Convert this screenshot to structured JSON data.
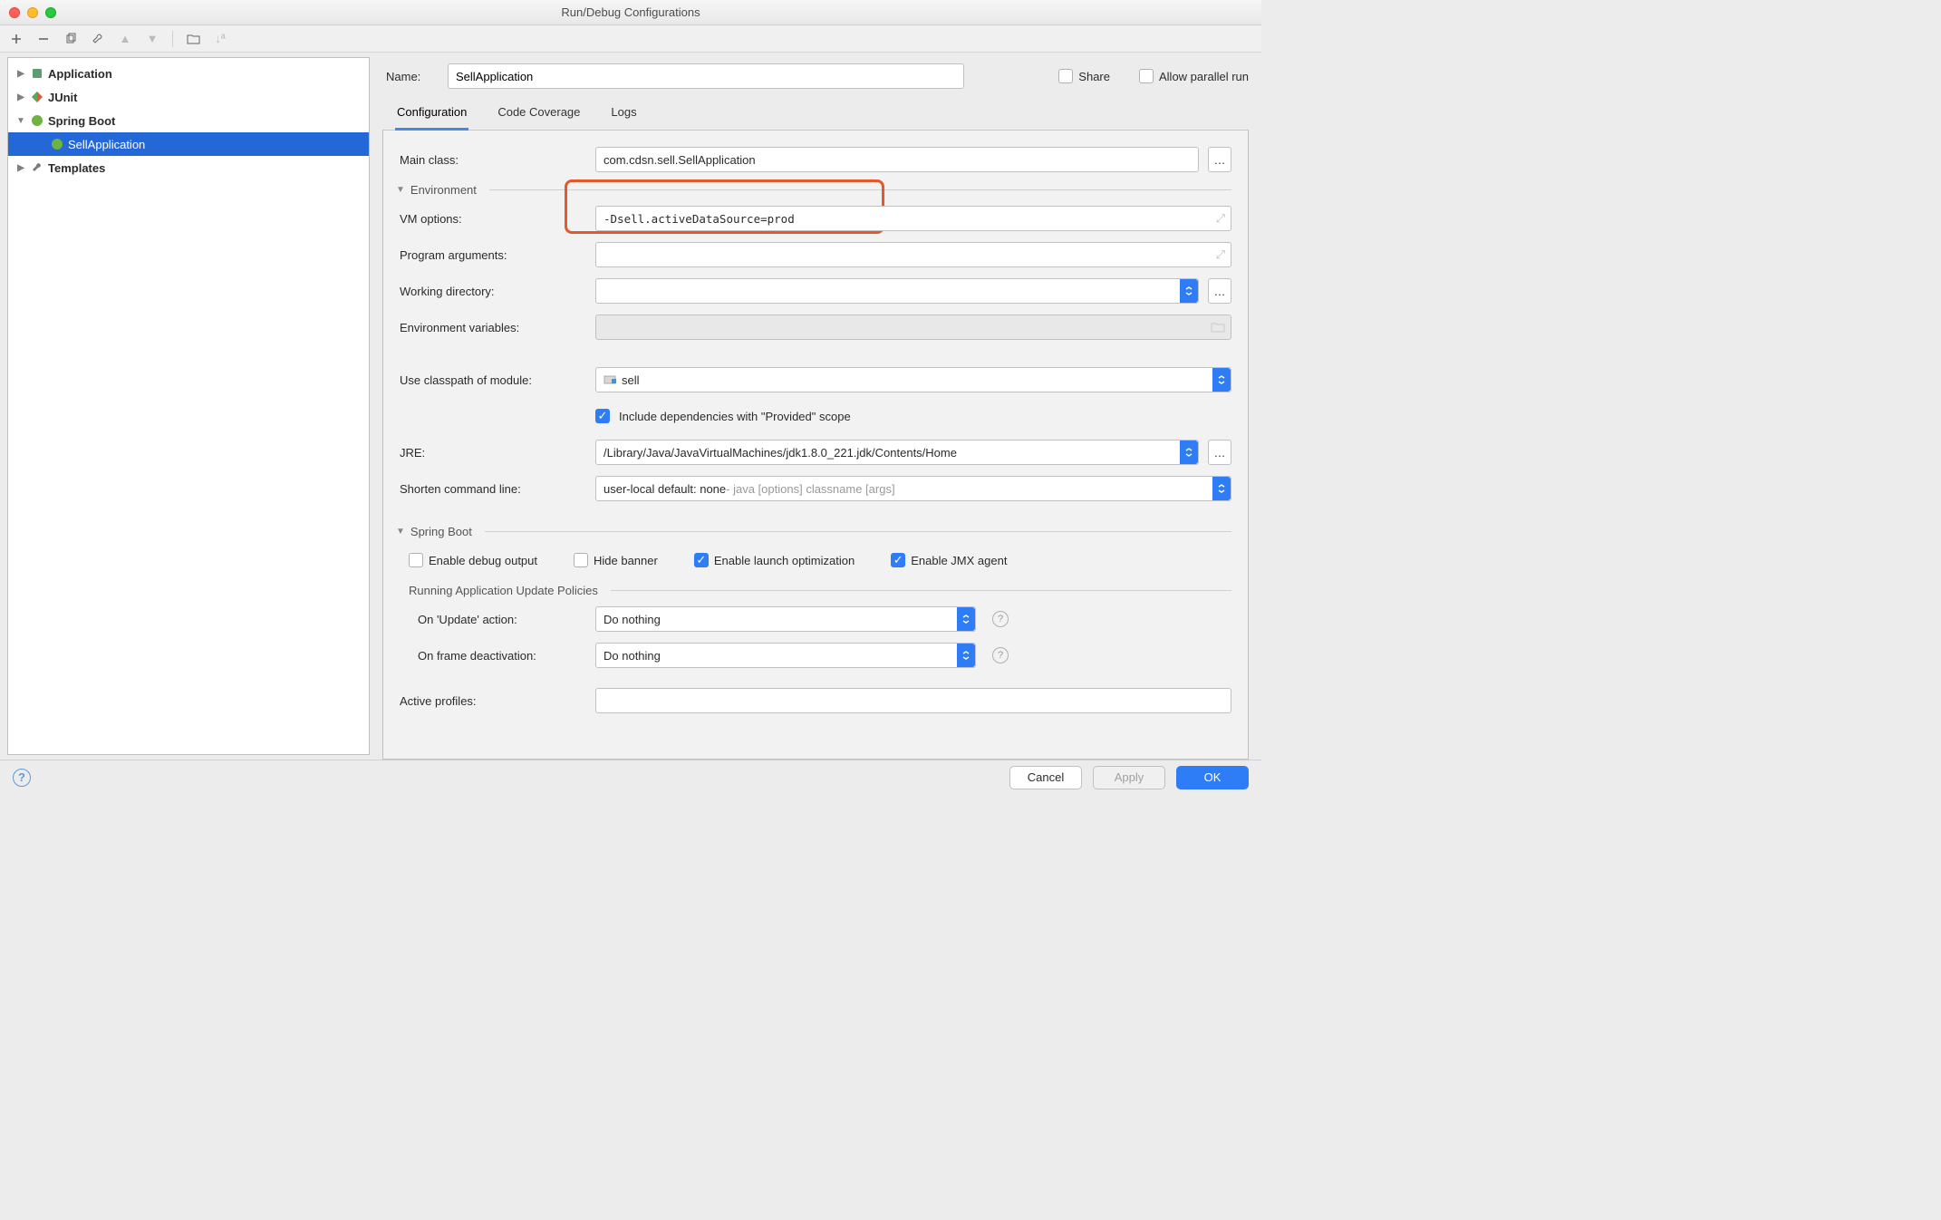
{
  "title": "Run/Debug Configurations",
  "sidebar": {
    "items": [
      {
        "label": "Application",
        "expanded": false,
        "bold": true
      },
      {
        "label": "JUnit",
        "expanded": false,
        "bold": true
      },
      {
        "label": "Spring Boot",
        "expanded": true,
        "bold": true
      },
      {
        "label": "SellApplication",
        "selected": true,
        "indent": 1
      },
      {
        "label": "Templates",
        "expanded": false,
        "bold": true
      }
    ]
  },
  "name": {
    "label": "Name:",
    "value": "SellApplication"
  },
  "share": {
    "label": "Share"
  },
  "parallel": {
    "label": "Allow parallel run"
  },
  "tabs": [
    "Configuration",
    "Code Coverage",
    "Logs"
  ],
  "form": {
    "main_class": {
      "label": "Main class:",
      "value": "com.cdsn.sell.SellApplication"
    },
    "env_header": "Environment",
    "vm_options": {
      "label": "VM options:",
      "value": "-Dsell.activeDataSource=prod"
    },
    "prog_args": {
      "label": "Program arguments:"
    },
    "work_dir": {
      "label": "Working directory:"
    },
    "env_vars": {
      "label": "Environment variables:"
    },
    "classpath": {
      "label": "Use classpath of module:",
      "value": "sell"
    },
    "include_provided": {
      "label": "Include dependencies with \"Provided\" scope",
      "checked": true
    },
    "jre": {
      "label": "JRE:",
      "value": "/Library/Java/JavaVirtualMachines/jdk1.8.0_221.jdk/Contents/Home"
    },
    "shorten": {
      "label": "Shorten command line:",
      "value": "user-local default: none",
      "hint": " - java [options] classname [args]"
    },
    "sb_header": "Spring Boot",
    "enable_debug": {
      "label": "Enable debug output",
      "checked": false
    },
    "hide_banner": {
      "label": "Hide banner",
      "checked": false
    },
    "launch_opt": {
      "label": "Enable launch optimization",
      "checked": true
    },
    "jmx": {
      "label": "Enable JMX agent",
      "checked": true
    },
    "update_header": "Running Application Update Policies",
    "on_update": {
      "label": "On 'Update' action:",
      "value": "Do nothing"
    },
    "on_deact": {
      "label": "On frame deactivation:",
      "value": "Do nothing"
    },
    "active_profiles": {
      "label": "Active profiles:"
    }
  },
  "footer": {
    "cancel": "Cancel",
    "apply": "Apply",
    "ok": "OK"
  }
}
